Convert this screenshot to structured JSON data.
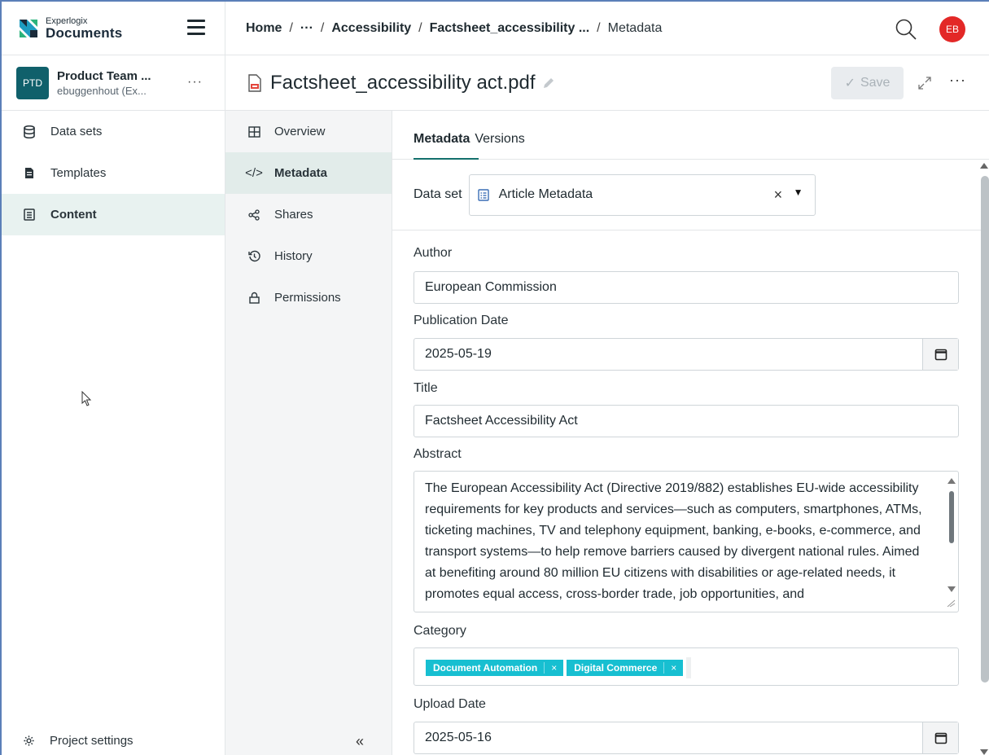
{
  "brand": {
    "line1": "Experlogix",
    "line2": "Documents"
  },
  "project": {
    "badge": "PTD",
    "name": "Product Team ...",
    "sub": "ebuggenhout (Ex...",
    "more": "···"
  },
  "sidebar": {
    "items": [
      {
        "label": "Data sets",
        "icon": "database-icon"
      },
      {
        "label": "Templates",
        "icon": "document-icon"
      },
      {
        "label": "Content",
        "icon": "content-icon",
        "active": true
      }
    ],
    "settings": "Project settings"
  },
  "breadcrumb": {
    "home": "Home",
    "sep": "/",
    "ellipsis": "···",
    "accessibility": "Accessibility",
    "factsheet": "Factsheet_accessibility ...",
    "current": "Metadata"
  },
  "user": {
    "initials": "EB",
    "color": "#e32827"
  },
  "document": {
    "title": "Factsheet_accessibility act.pdf",
    "save_label": "Save",
    "more": "···"
  },
  "subnav": {
    "items": [
      {
        "label": "Overview"
      },
      {
        "label": "Metadata",
        "active": true
      },
      {
        "label": "Shares"
      },
      {
        "label": "History"
      },
      {
        "label": "Permissions"
      }
    ],
    "collapse": "«"
  },
  "tabs": {
    "metadata": "Metadata",
    "versions": "Versions"
  },
  "dataset": {
    "label": "Data set",
    "value": "Article Metadata",
    "clear": "×"
  },
  "fields": {
    "author_label": "Author",
    "author": "European Commission",
    "pub_date_label": "Publication Date",
    "pub_date": "2025-05-19",
    "title_label": "Title",
    "title": "Factsheet Accessibility Act",
    "abstract_label": "Abstract",
    "abstract": "The European Accessibility Act (Directive 2019/882) establishes EU-wide accessibility requirements for key products and services—such as computers, smartphones, ATMs, ticketing machines, TV and telephony equipment, banking, e-books, e-commerce, and transport systems—to help remove barriers caused by divergent national rules. Aimed at benefiting around 80 million EU citizens with disabilities or age-related needs, it promotes equal access, cross-border trade, job opportunities, and",
    "category_label": "Category",
    "categories": [
      "Document Automation",
      "Digital Commerce"
    ],
    "chip_remove": "×",
    "upload_date_label": "Upload Date",
    "upload_date": "2025-05-16"
  },
  "colors": {
    "accent": "#14706c",
    "chip": "#17bfd1",
    "project_badge": "#10606b"
  }
}
